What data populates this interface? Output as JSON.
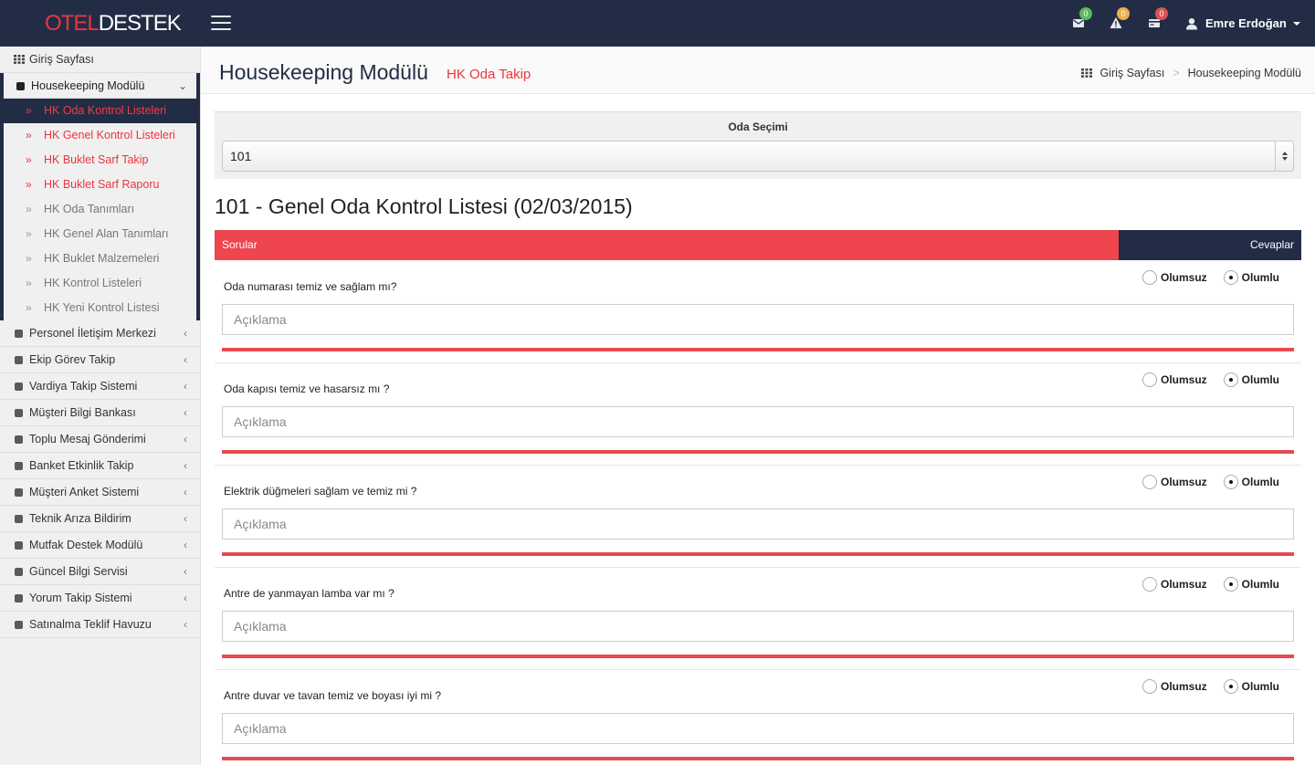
{
  "header": {
    "logo_red": "OTEL",
    "logo_white": "DESTEK",
    "notifications": [
      {
        "icon": "envelope-icon",
        "count": "0",
        "color": "#5cb85c"
      },
      {
        "icon": "warning-icon",
        "count": "0",
        "color": "#f0ad4e"
      },
      {
        "icon": "card-icon",
        "count": "0",
        "color": "#d9534f"
      }
    ],
    "user_name": "Emre Erdoğan"
  },
  "sidebar": {
    "home": "Giriş Sayfası",
    "group": {
      "label": "Housekeeping Modülü",
      "items": [
        {
          "label": "HK Oda Kontrol Listeleri",
          "state": "active"
        },
        {
          "label": "HK Genel Kontrol Listeleri",
          "state": "red"
        },
        {
          "label": "HK Buklet Sarf Takip",
          "state": "red"
        },
        {
          "label": "HK Buklet Sarf Raporu",
          "state": "red"
        },
        {
          "label": "HK Oda Tanımları",
          "state": "gray"
        },
        {
          "label": "HK Genel Alan Tanımları",
          "state": "gray"
        },
        {
          "label": "HK Buklet Malzemeleri",
          "state": "gray"
        },
        {
          "label": "HK Kontrol Listeleri",
          "state": "gray"
        },
        {
          "label": "HK Yeni Kontrol Listesi",
          "state": "gray"
        }
      ]
    },
    "items": [
      "Personel İletişim Merkezi",
      "Ekip Görev Takip",
      "Vardiya Takip Sistemi",
      "Müşteri Bilgi Bankası",
      "Toplu Mesaj Gönderimi",
      "Banket Etkinlik Takip",
      "Müşteri Anket Sistemi",
      "Teknik Arıza Bildirim",
      "Mutfak Destek Modülü",
      "Güncel Bilgi Servisi",
      "Yorum Takip Sistemi",
      "Satınalma Teklif Havuzu"
    ]
  },
  "page": {
    "title": "Housekeeping Modülü",
    "subtitle": "HK Oda Takip",
    "breadcrumb": [
      "Giriş Sayfası",
      ">",
      "Housekeeping Modülü"
    ]
  },
  "room": {
    "label": "Oda Seçimi",
    "selected": "101"
  },
  "checklist": {
    "title": "101 - Genel Oda Kontrol Listesi (02/03/2015)",
    "col_questions": "Sorular",
    "col_answers": "Cevaplar",
    "option_negative": "Olumsuz",
    "option_positive": "Olumlu",
    "placeholder": "Açıklama",
    "questions": [
      {
        "text": "Oda numarası temiz ve sağlam mı?",
        "answer": "Olumlu"
      },
      {
        "text": "Oda kapısı temiz ve hasarsız mı ?",
        "answer": "Olumlu"
      },
      {
        "text": "Elektrik düğmeleri sağlam ve temiz mi ?",
        "answer": "Olumlu"
      },
      {
        "text": "Antre de yanmayan lamba var mı ?",
        "answer": "Olumlu"
      },
      {
        "text": "Antre duvar ve tavan temiz ve boyası iyi mi ?",
        "answer": "Olumlu"
      }
    ]
  }
}
